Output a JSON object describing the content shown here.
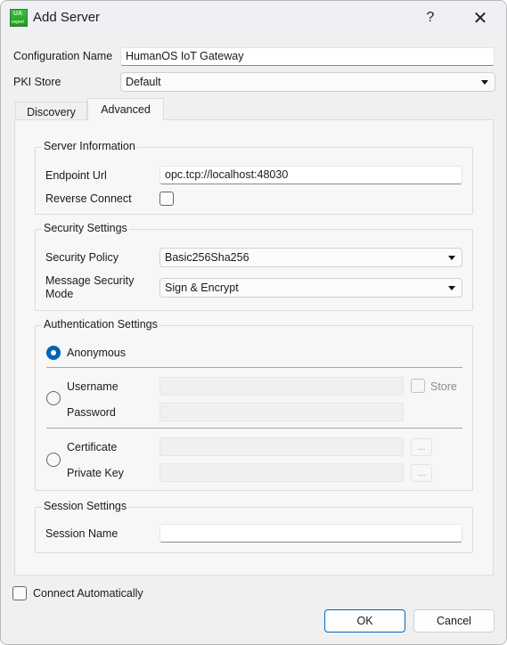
{
  "window": {
    "title": "Add Server",
    "icon": "uaexpert-app-icon",
    "icon_text_top": "UA",
    "icon_text_bottom": "expert",
    "help_label": "?",
    "close_label": "✕"
  },
  "form": {
    "config_name_label": "Configuration Name",
    "config_name_value": "HumanOS IoT Gateway",
    "pki_store_label": "PKI Store",
    "pki_store_value": "Default"
  },
  "tabs": [
    {
      "label": "Discovery",
      "active": false
    },
    {
      "label": "Advanced",
      "active": true
    }
  ],
  "server_info": {
    "title": "Server Information",
    "endpoint_label": "Endpoint Url",
    "endpoint_value": "opc.tcp://localhost:48030",
    "reverse_connect_label": "Reverse Connect",
    "reverse_connect_checked": false
  },
  "security": {
    "title": "Security Settings",
    "policy_label": "Security Policy",
    "policy_value": "Basic256Sha256",
    "mode_label_line1": "Message Security",
    "mode_label_line2": "Mode",
    "mode_value": "Sign & Encrypt"
  },
  "auth": {
    "title": "Authentication Settings",
    "anonymous_label": "Anonymous",
    "selected": "anonymous",
    "username_label": "Username",
    "username_value": "",
    "password_label": "Password",
    "password_value": "",
    "store_label": "Store",
    "store_checked": false,
    "certificate_label": "Certificate",
    "certificate_value": "",
    "private_key_label": "Private Key",
    "private_key_value": "",
    "browse_label": "..."
  },
  "session": {
    "title": "Session Settings",
    "name_label": "Session Name",
    "name_value": ""
  },
  "footer": {
    "connect_auto_label": "Connect Automatically",
    "connect_auto_checked": false,
    "ok_label": "OK",
    "cancel_label": "Cancel"
  },
  "colors": {
    "accent": "#0063b1",
    "default_button_border": "#0067c0"
  }
}
